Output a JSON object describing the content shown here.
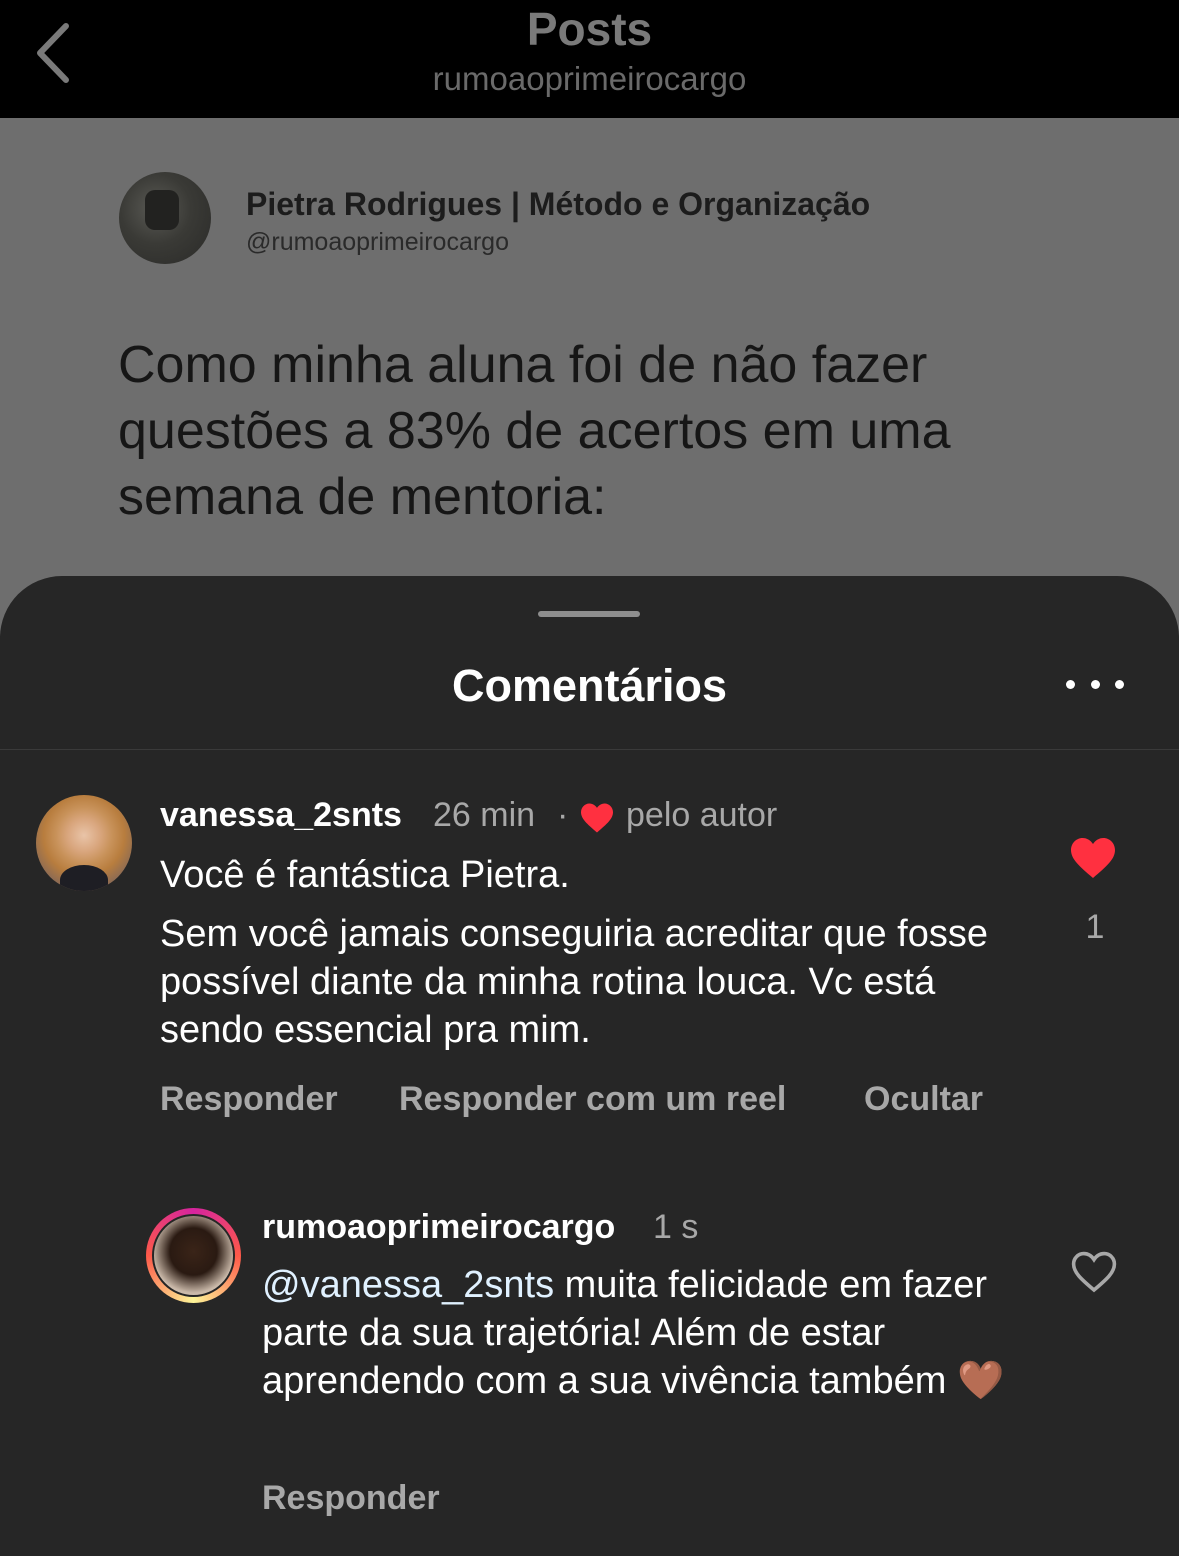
{
  "nav": {
    "title": "Posts",
    "subtitle": "rumoaoprimeirocargo"
  },
  "post": {
    "author_name": "Pietra Rodrigues | Método e Organização",
    "author_handle": "@rumoaoprimeirocargo",
    "text": "Como minha aluna foi de não fazer questões a 83% de acertos em uma semana de mentoria:"
  },
  "comments_sheet": {
    "title": "Comentários",
    "comments": [
      {
        "username": "vanessa_2snts",
        "time": "26 min",
        "separator": "·",
        "liked_by_author": "pelo autor",
        "line1": "Você é fantástica Pietra.",
        "body": "Sem você jamais conseguiria acreditar que fosse possível diante da minha rotina louca. Vc está sendo essencial pra mim.",
        "likes": "1",
        "actions": [
          "Responder",
          "Responder com um reel",
          "Ocultar"
        ]
      },
      {
        "username": "rumoaoprimeirocargo",
        "time": "1 s",
        "mention": "@vanessa_2snts",
        "body": " muita felicidade em fazer parte da sua trajetória! Além de estar aprendendo com a sua vivência também ",
        "emoji": "🤎",
        "actions": [
          "Responder"
        ]
      }
    ]
  },
  "colors": {
    "like_red": "#ff3040",
    "sheet_bg": "#262626",
    "secondary_text": "#a8a8a8"
  },
  "icons": {
    "back": "chevron-left-icon",
    "more": "more-horizontal-icon",
    "heart_filled": "heart-filled-icon",
    "heart_outline": "heart-outline-icon"
  }
}
